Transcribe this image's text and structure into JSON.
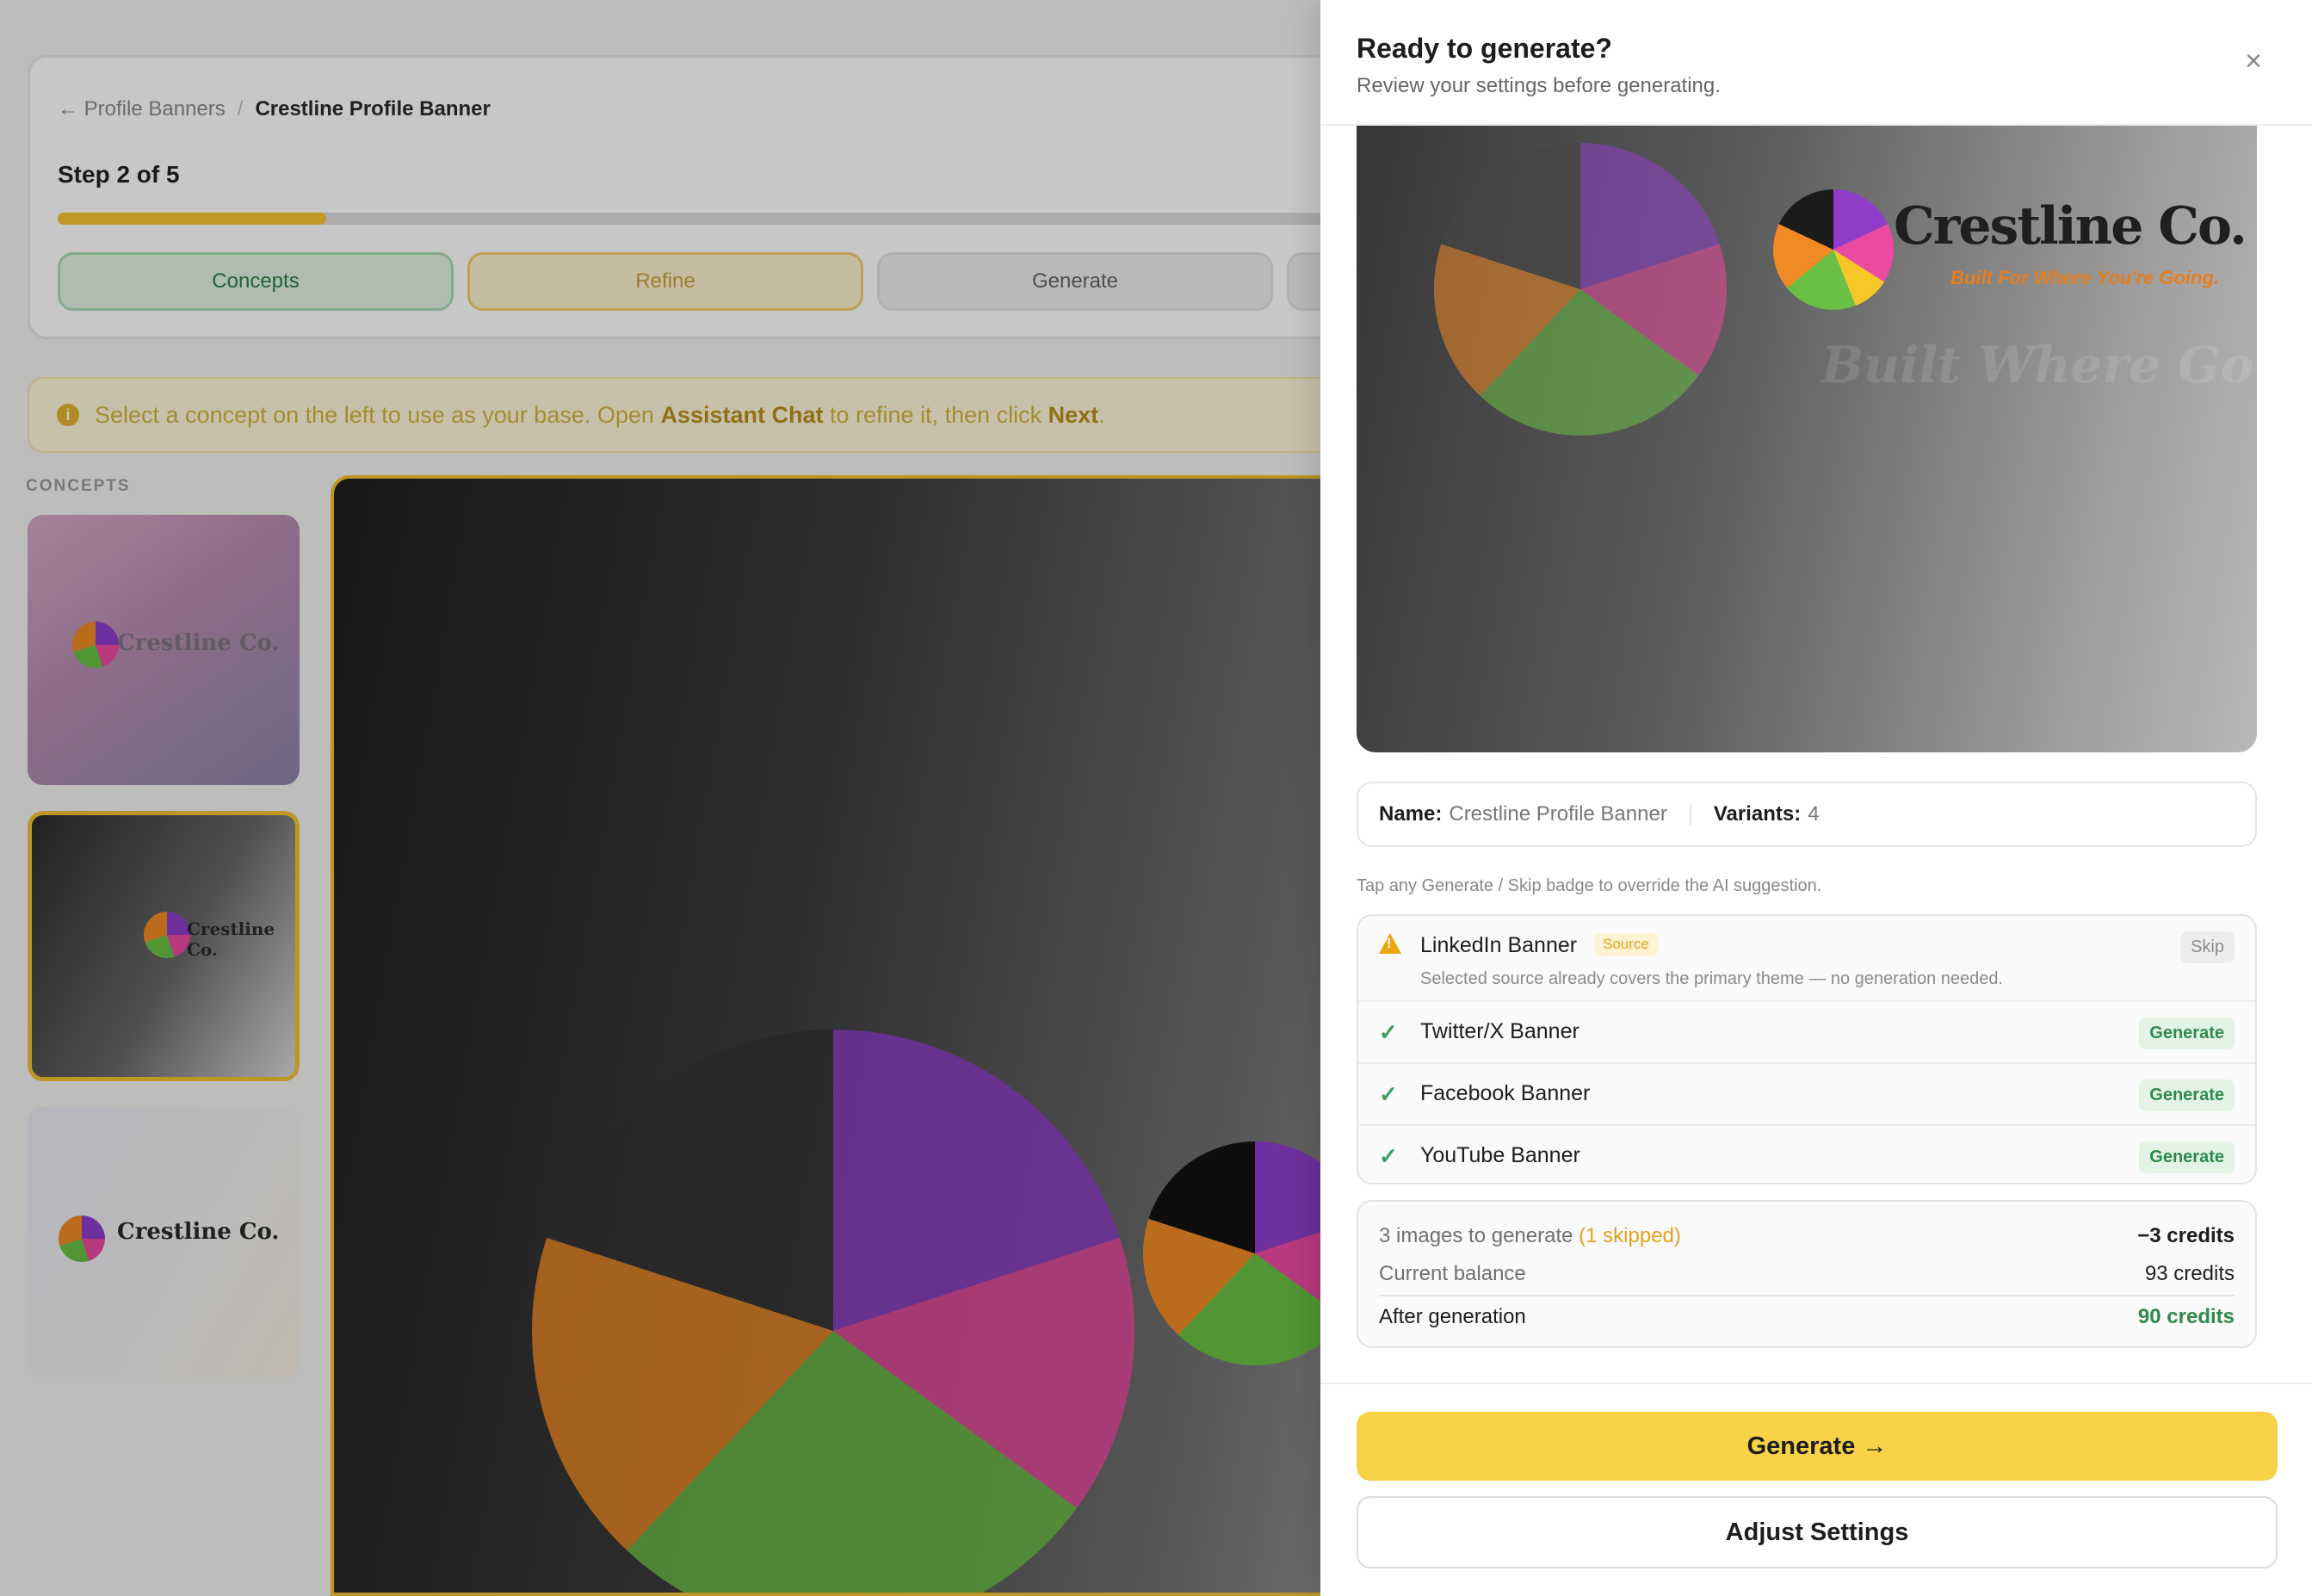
{
  "background": {
    "breadcrumb": {
      "back": "← Profile Banners",
      "separator": "/",
      "current": "Crestline Profile Banner"
    },
    "step_label": "Step 2 of 5",
    "progress": 0.2,
    "steps": [
      {
        "label": "Concepts"
      },
      {
        "label": "Refine"
      },
      {
        "label": "Generate"
      }
    ],
    "hint": {
      "icon": "info-icon",
      "text_before": "Select a concept on the left to use as your base. Open",
      "highlight_1": "Assistant Chat",
      "text_middle": "to refine it, then click",
      "highlight_2": "Next",
      "text_after": "."
    },
    "concepts_label": "CONCEPTS",
    "concept_thumbs": [
      {
        "logo_text": "Crestline Co."
      },
      {
        "logo_text": "Crestline Co."
      },
      {
        "logo_text": "Crestline Co."
      }
    ]
  },
  "drawer": {
    "title": "Ready to generate?",
    "subtitle": "Review your settings before generating.",
    "close_icon": "×",
    "preview": {
      "brand": "Crestline Co.",
      "tagline": "Built For Where You're Going.",
      "ghost_text": "Built Where Gou'e G"
    },
    "meta": {
      "name_label": "Name:",
      "name_value": "Crestline Profile Banner",
      "variants_label": "Variants:",
      "variants_value": "4"
    },
    "tap_hint": "Tap any Generate / Skip badge to override the AI suggestion.",
    "platforms": [
      {
        "name": "LinkedIn Banner",
        "tag": "Source",
        "note": "Selected source already covers the primary theme — no generation needed.",
        "action": "Skip",
        "status": "warning"
      },
      {
        "name": "Twitter/X Banner",
        "action": "Generate",
        "status": "check"
      },
      {
        "name": "Facebook Banner",
        "action": "Generate",
        "status": "check"
      },
      {
        "name": "YouTube Banner",
        "action": "Generate",
        "status": "check"
      }
    ],
    "cost": {
      "line1_label": "3 images to generate",
      "line1_skipped": "(1 skipped)",
      "line1_value": "−3 credits",
      "line2_label": "Current balance",
      "line2_value": "93 credits",
      "line3_label": "After generation",
      "line3_value": "90 credits"
    },
    "primary_button": "Generate →",
    "secondary_button": "Adjust Settings"
  },
  "colors": {
    "accent": "#f7d146",
    "success": "#2f8a4c",
    "warning": "#e2a21a"
  }
}
